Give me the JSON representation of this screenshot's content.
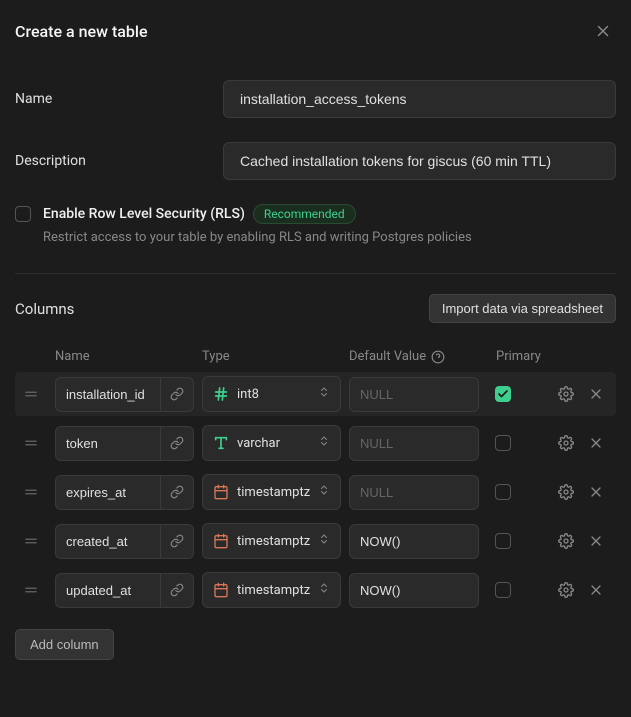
{
  "header": {
    "title": "Create a new table"
  },
  "form": {
    "name_label": "Name",
    "name_value": "installation_access_tokens",
    "desc_label": "Description",
    "desc_value": "Cached installation tokens for giscus (60 min TTL)"
  },
  "rls": {
    "title": "Enable Row Level Security (RLS)",
    "badge": "Recommended",
    "description": "Restrict access to your table by enabling RLS and writing Postgres policies"
  },
  "columns_section": {
    "title": "Columns",
    "import_label": "Import data via spreadsheet",
    "headers": {
      "name": "Name",
      "type": "Type",
      "default": "Default Value",
      "primary": "Primary"
    },
    "add_label": "Add column"
  },
  "columns": [
    {
      "name": "installation_id",
      "type": "int8",
      "type_icon": "hash",
      "default": "",
      "default_placeholder": "NULL",
      "primary": true
    },
    {
      "name": "token",
      "type": "varchar",
      "type_icon": "text",
      "default": "",
      "default_placeholder": "NULL",
      "primary": false
    },
    {
      "name": "expires_at",
      "type": "timestamptz",
      "type_icon": "calendar",
      "default": "",
      "default_placeholder": "NULL",
      "primary": false
    },
    {
      "name": "created_at",
      "type": "timestamptz",
      "type_icon": "calendar",
      "default": "NOW()",
      "default_placeholder": "NULL",
      "primary": false
    },
    {
      "name": "updated_at",
      "type": "timestamptz",
      "type_icon": "calendar",
      "default": "NOW()",
      "default_placeholder": "NULL",
      "primary": false
    }
  ]
}
